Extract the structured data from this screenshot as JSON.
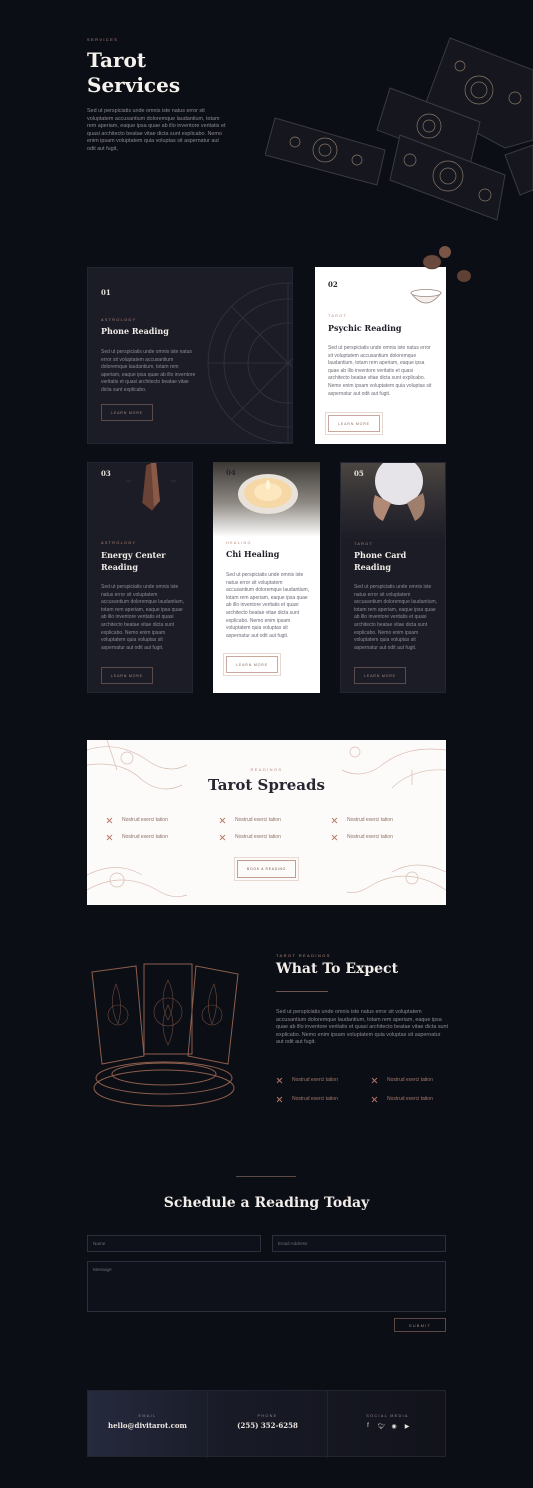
{
  "hero": {
    "eyebrow": "Services",
    "title_line1": "Tarot",
    "title_line2": "Services",
    "text": "Sed ut perspiciatis unde omnis iste natus error sit voluptatem accusantium doloremque laudantium, totam rem aperiam, eaque ipsa quae ab illo inventore veritatis et quasi architecto beatae vitae dicta sunt explicabo. Nemo enim ipsam voluptatem quia voluptas sit aspernatur aut odit aut fugit,"
  },
  "services": [
    {
      "number": "01",
      "category": "Astrology",
      "title": "Phone Reading",
      "text": "Sed ut perspiciatis unde omnis iste natus error sit voluptatem accusantium doloremque laudantium, totam rem aperiam, eaque ipsa quae ab illo inventore veritatis et quasi architecto beatae vitae dicta sunt explicabo.",
      "button": "Learn More"
    },
    {
      "number": "02",
      "category": "Tarot",
      "title": "Psychic Reading",
      "text": "Sed ut perspiciatis unde omnis iste natus error sit voluptatem accusantium doloremque laudantium, totam rem aperiam, eaque ipsa quae ab illo inventore veritatis et quasi architecto beatae vitae dicta sunt explicabo. Nemo enim ipsam voluptatem quia voluptas sit aspernatur aut odit aut fugit.",
      "button": "Learn More"
    },
    {
      "number": "03",
      "category": "Astrology",
      "title_line1": "Energy Center",
      "title_line2": "Reading",
      "text": "Sed ut perspiciatis unde omnis iste natus error sit voluptatem accusantium doloremque laudantium, totam rem aperiam, eaque ipsa quae ab illo inventore veritatis et quasi architecto beatae vitae dicta sunt explicabo. Nemo enim ipsam voluptatem quia voluptas sit aspernatur aut odit aut fugit.",
      "button": "Learn More"
    },
    {
      "number": "04",
      "category": "Healing",
      "title": "Chi Healing",
      "text": "Sed ut perspiciatis unde omnis iste natus error sit voluptatem accusantium doloremque laudantium, totam rem aperiam, eaque ipsa quae ab illo inventore veritatis et quasi architecto beatae vitae dicta sunt explicabo. Nemo enim ipsam voluptatem quia voluptas sit aspernatur aut odit aut fugit.",
      "button": "Learn More"
    },
    {
      "number": "05",
      "category": "Tarot",
      "title_line1": "Phone Card",
      "title_line2": "Reading",
      "text": "Sed ut perspiciatis unde omnis iste natus error sit voluptatem accusantium doloremque laudantium, totam rem aperiam, eaque ipsa quae ab illo inventore veritatis et quasi architecto beatae vitae dicta sunt explicabo. Nemo enim ipsam voluptatem quia voluptas sit aspernatur aut odit aut fugit.",
      "button": "Learn More"
    }
  ],
  "spreads": {
    "eyebrow": "Readings",
    "title": "Tarot Spreads",
    "items": [
      "Nostrud exerci tation",
      "Nostrud exerci tation",
      "Nostrud exerci tation",
      "Nostrud exerci tation",
      "Nostrud exerci tation",
      "Nostrud exerci tation"
    ],
    "button": "Book a Reading"
  },
  "expect": {
    "eyebrow": "Tarot Readings",
    "title": "What To Expect",
    "text": "Sed ut perspiciatis unde omnis iste natus error sit voluptatem accusantium doloremque laudantium, totam rem aperiam, eaque ipsa quae ab illo inventore veritatis et quasi architecto beatae vitae dicta sunt explicabo. Nemo enim ipsam voluptatem quia voluptas sit aspernatur aut odit aut fugit.",
    "items": [
      "Nostrud exerci tation",
      "Nostrud exerci tation",
      "Nostrud exerci tation",
      "Nostrud exerci tation"
    ]
  },
  "schedule": {
    "title": "Schedule a Reading Today",
    "name_placeholder": "Name",
    "email_placeholder": "Email Address",
    "message_placeholder": "Message",
    "submit": "Submit"
  },
  "footer": {
    "email_label": "Email",
    "email": "hello@divitarot.com",
    "phone_label": "Phone",
    "phone": "(255) 352-6258",
    "social_label": "Social Media",
    "social_icons": [
      "facebook-icon",
      "twitter-icon",
      "instagram-icon",
      "youtube-icon"
    ]
  },
  "colors": {
    "background": "#0c0e16",
    "card_dark": "#1b1c26",
    "accent": "#b8877a"
  }
}
